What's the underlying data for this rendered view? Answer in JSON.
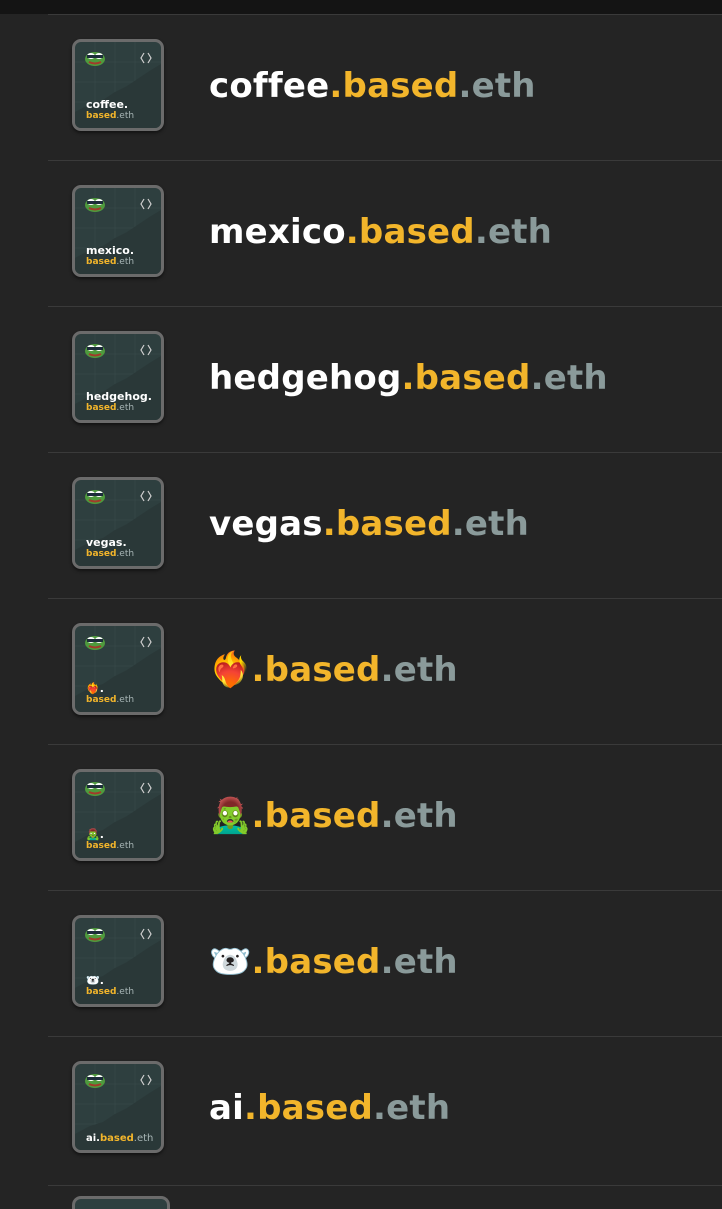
{
  "colors": {
    "background": "#242424",
    "name_white": "#ffffff",
    "based_gold": "#f2b52b",
    "eth_gray": "#8a9a9a",
    "card_bg": "#2e3f3f"
  },
  "items": [
    {
      "label": "coffee",
      "sep1": ".",
      "based": "based",
      "sep2": ".",
      "tld": "eth",
      "thumb_label": "coffee.",
      "thumb_based": "based",
      "thumb_tld": ".eth",
      "emoji": false
    },
    {
      "label": "mexico",
      "sep1": ".",
      "based": "based",
      "sep2": ".",
      "tld": "eth",
      "thumb_label": "mexico.",
      "thumb_based": "based",
      "thumb_tld": ".eth",
      "emoji": false
    },
    {
      "label": "hedgehog",
      "sep1": ".",
      "based": "based",
      "sep2": ".",
      "tld": "eth",
      "thumb_label": "hedgehog.",
      "thumb_based": "based",
      "thumb_tld": ".eth",
      "emoji": false
    },
    {
      "label": "vegas",
      "sep1": ".",
      "based": "based",
      "sep2": ".",
      "tld": "eth",
      "thumb_label": "vegas.",
      "thumb_based": "based",
      "thumb_tld": ".eth",
      "emoji": false
    },
    {
      "label": "❤️‍🔥",
      "sep1": ".",
      "based": "based",
      "sep2": ".",
      "tld": "eth",
      "thumb_label": "❤️‍🔥.",
      "thumb_based": "based",
      "thumb_tld": ".eth",
      "emoji": true
    },
    {
      "label": "🧟‍♂️",
      "sep1": ".",
      "based": "based",
      "sep2": ".",
      "tld": "eth",
      "thumb_label": "🧟‍♂️.",
      "thumb_based": "based",
      "thumb_tld": ".eth",
      "emoji": true
    },
    {
      "label": "🐻‍❄️",
      "sep1": ".",
      "based": "based",
      "sep2": ".",
      "tld": "eth",
      "thumb_label": "🐻‍❄️.",
      "thumb_based": "based",
      "thumb_tld": ".eth",
      "emoji": true
    },
    {
      "label": "ai",
      "sep1": ".",
      "based": "based",
      "sep2": ".",
      "tld": "eth",
      "thumb_label": "ai.",
      "thumb_based": "based",
      "thumb_tld": ".eth",
      "emoji": false,
      "single_line_thumb": true
    }
  ],
  "icons": {
    "thumb_avatar": "pepe-frog-icon",
    "thumb_corner": "code-brackets-icon"
  }
}
